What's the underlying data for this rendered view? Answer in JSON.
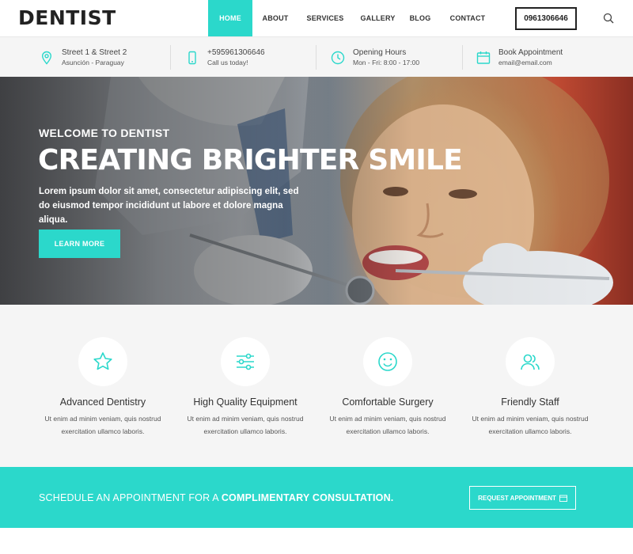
{
  "header": {
    "logo": "DENTIST",
    "nav": [
      "HOME",
      "ABOUT",
      "SERVICES",
      "GALLERY",
      "BLOG",
      "CONTACT"
    ],
    "phone": "0961306646"
  },
  "info": [
    {
      "icon": "map-pin-icon",
      "line1": "Street 1 & Street 2",
      "line2": "Asunción - Paraguay"
    },
    {
      "icon": "phone-icon",
      "line1": "+595961306646",
      "line2": "Call us today!"
    },
    {
      "icon": "clock-icon",
      "line1": "Opening Hours",
      "line2": "Mon - Fri: 8:00 - 17:00"
    },
    {
      "icon": "calendar-icon",
      "line1": "Book Appointment",
      "line2": "email@email.com"
    }
  ],
  "hero": {
    "eyebrow": "WELCOME TO DENTIST",
    "title": "CREATING BRIGHTER SMILE",
    "text": "Lorem ipsum dolor sit amet, consectetur adipiscing elit, sed do eiusmod tempor incididunt ut labore et dolore magna aliqua.",
    "button": "LEARN MORE"
  },
  "features": [
    {
      "icon": "star-icon",
      "title": "Advanced Dentistry",
      "text": "Ut enim ad minim veniam, quis nostrud exercitation ullamco laboris."
    },
    {
      "icon": "sliders-icon",
      "title": "High Quality Equipment",
      "text": "Ut enim ad minim veniam, quis nostrud exercitation ullamco laboris."
    },
    {
      "icon": "smile-icon",
      "title": "Comfortable Surgery",
      "text": "Ut enim ad minim veniam, quis nostrud exercitation ullamco laboris."
    },
    {
      "icon": "users-icon",
      "title": "Friendly Staff",
      "text": "Ut enim ad minim veniam, quis nostrud exercitation ullamco laboris."
    }
  ],
  "cta": {
    "text_plain": "SCHEDULE AN APPOINTMENT FOR A ",
    "text_bold": "COMPLIMENTARY CONSULTATION.",
    "button": "REQUEST APPOINTMENT"
  },
  "colors": {
    "accent": "#2bd8cb",
    "dark": "#222222",
    "light_bg": "#f5f5f5"
  }
}
